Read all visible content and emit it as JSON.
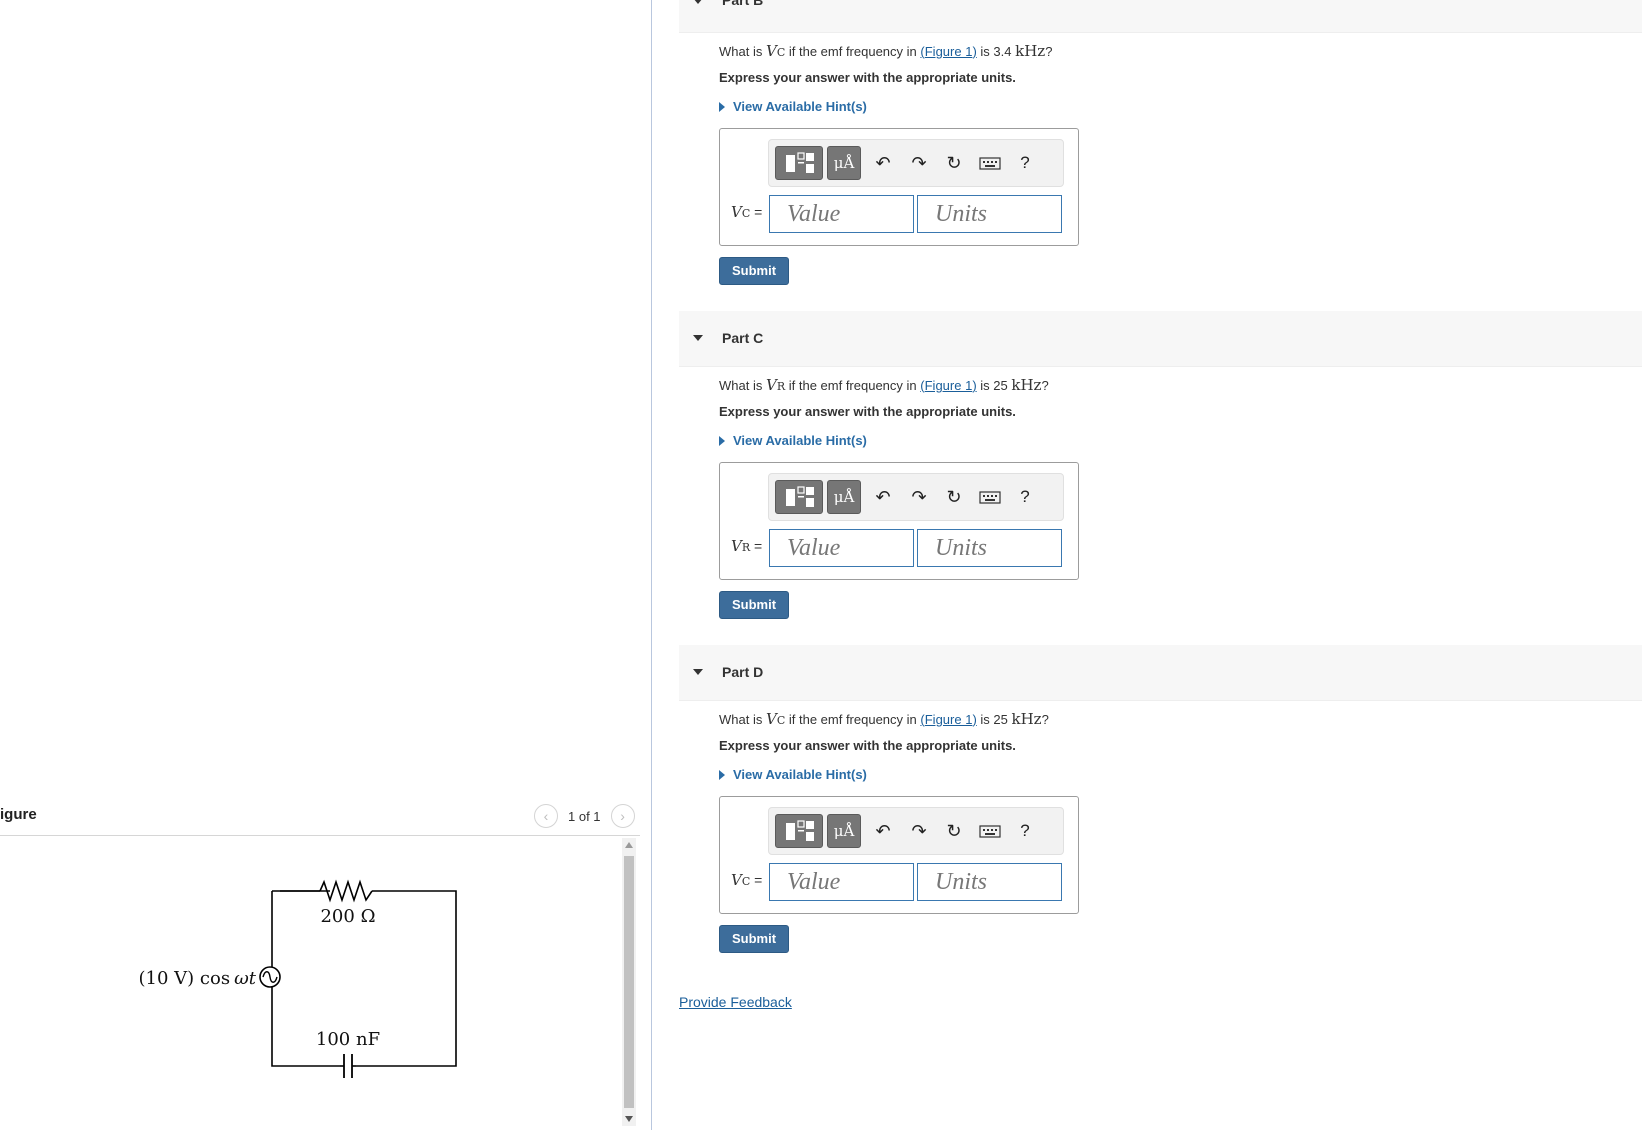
{
  "figure_panel": {
    "title": "igure",
    "pager_text": "1 of 1",
    "circuit": {
      "resistor_label": "200 Ω",
      "capacitor_label": "100 nF",
      "source_label_prefix": "(10 V) cos",
      "source_label_var": "ωt"
    }
  },
  "parts": [
    {
      "header": "Part B",
      "question_pre": "What is",
      "symbol": "V",
      "subscript": "C",
      "question_mid": "if the emf frequency in",
      "link_open": "(",
      "link_text": "Figure 1",
      "link_close": ")",
      "question_is": "is",
      "freq_value": "3.4",
      "freq_unit": "kHz",
      "question_end": "?",
      "instruction": "Express your answer with the appropriate units.",
      "hint": "View Available Hint(s)",
      "var_eq": "=",
      "value_placeholder": "Value",
      "units_placeholder": "Units",
      "submit": "Submit"
    },
    {
      "header": "Part C",
      "question_pre": "What is",
      "symbol": "V",
      "subscript": "R",
      "question_mid": "if the emf frequency in",
      "link_open": "(",
      "link_text": "Figure 1",
      "link_close": ")",
      "question_is": "is",
      "freq_value": "25",
      "freq_unit": "kHz",
      "question_end": "?",
      "instruction": "Express your answer with the appropriate units.",
      "hint": "View Available Hint(s)",
      "var_eq": "=",
      "value_placeholder": "Value",
      "units_placeholder": "Units",
      "submit": "Submit"
    },
    {
      "header": "Part D",
      "question_pre": "What is",
      "symbol": "V",
      "subscript": "C",
      "question_mid": "if the emf frequency in",
      "link_open": "(",
      "link_text": "Figure 1",
      "link_close": ")",
      "question_is": "is",
      "freq_value": "25",
      "freq_unit": "kHz",
      "question_end": "?",
      "instruction": "Express your answer with the appropriate units.",
      "hint": "View Available Hint(s)",
      "var_eq": "=",
      "value_placeholder": "Value",
      "units_placeholder": "Units",
      "submit": "Submit"
    }
  ],
  "toolbar": {
    "units_button": "μÅ",
    "icons": [
      "templates-icon",
      "units-icon",
      "undo-icon",
      "redo-icon",
      "reset-icon",
      "keyboard-icon",
      "help-icon"
    ],
    "help_glyph": "?"
  },
  "feedback_link": "Provide Feedback",
  "colors": {
    "link": "#1a5e9a",
    "hint": "#2a6ca6",
    "submit_bg": "#3d6d9b",
    "field_border": "#3a78b0",
    "toolbar_button": "#767676"
  }
}
